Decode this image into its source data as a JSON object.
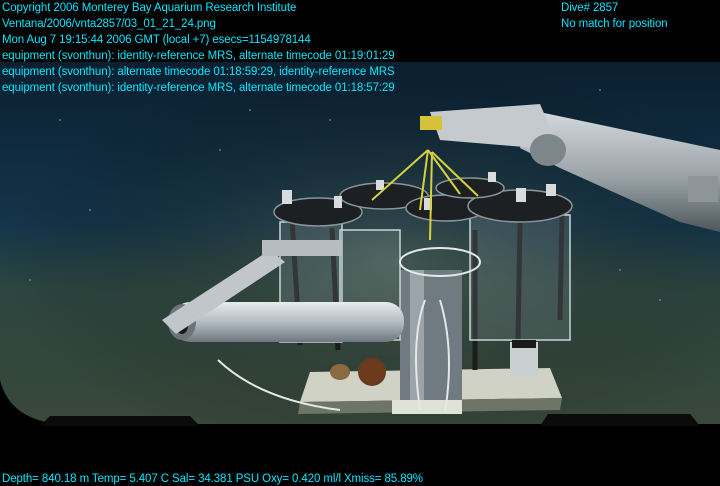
{
  "overlay": {
    "left_lines": [
      "Copyright 2006 Monterey Bay Aquarium Research Institute",
      "Ventana/2006/vnta2857/03_01_21_24.png",
      "Mon Aug  7 19:15:44 2006 GMT (local +7)  esecs=1154978144",
      "equipment (svonthun): identity-reference MRS, alternate timecode 01:19:01:29",
      "equipment (svonthun): alternate timecode 01:18:59:29, identity-reference MRS",
      "equipment (svonthun): identity-reference MRS, alternate timecode 01:18:57:29"
    ],
    "right_lines": [
      "Dive# 2857",
      "No match for position"
    ],
    "footer": "Depth= 840.18 m  Temp= 5.407 C  Sal= 34.381 PSU  Oxy= 0.420 ml/l  Xmiss= 85.89%",
    "text_color": "#00e8ff"
  },
  "scene": {
    "water_color": "#0d2a3c",
    "seafloor_color": "#3a4a3a",
    "vignette_color": "#000000"
  }
}
